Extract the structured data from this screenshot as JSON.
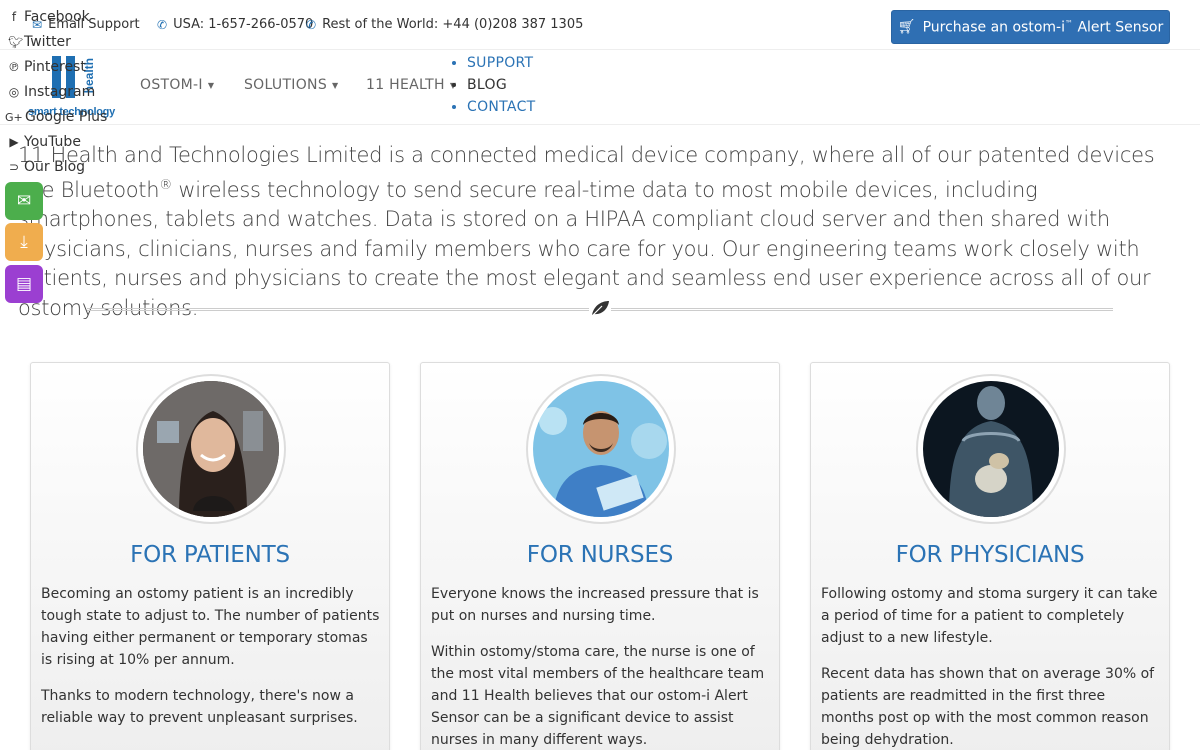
{
  "topbar": {
    "email_label": "Email Support",
    "usa_label": "USA: 1-657-266-0570",
    "world_label": "Rest of the World: +44 (0)208 387 1305",
    "purchase_label": "Purchase an ostom-i",
    "purchase_tm": "™",
    "purchase_suffix": "Alert Sensor"
  },
  "logo": {
    "health": "health",
    "tagline": "smart technology"
  },
  "nav": {
    "items": [
      {
        "label": "OSTOM-I"
      },
      {
        "label": "SOLUTIONS"
      },
      {
        "label": "11 HEALTH"
      }
    ],
    "links": [
      {
        "label": "SUPPORT"
      },
      {
        "label": "BLOG"
      },
      {
        "label": "CONTACT"
      }
    ]
  },
  "social": [
    {
      "icon": "facebook-icon",
      "label": "Facebook"
    },
    {
      "icon": "twitter-icon",
      "label": "Twitter"
    },
    {
      "icon": "pinterest-icon",
      "label": "Pinterest"
    },
    {
      "icon": "instagram-icon",
      "label": "Instagram"
    },
    {
      "icon": "google-plus-icon",
      "label": "Google Plus"
    },
    {
      "icon": "youtube-icon",
      "label": "YouTube"
    },
    {
      "icon": "rss-icon",
      "label": "Our Blog"
    }
  ],
  "float_buttons": [
    {
      "icon": "envelope-icon",
      "color": "#4cae4c"
    },
    {
      "icon": "download-icon",
      "color": "#f0ad4e"
    },
    {
      "icon": "newspaper-icon",
      "color": "#9b3fd1"
    }
  ],
  "intro": {
    "part1": "11 Health and Technologies Limited is a connected medical device company, where all of our patented devices use Bluetooth",
    "reg": "®",
    "part2": " wireless technology to send secure real-time data to most mobile devices, including smartphones, tablets and watches. Data is stored on a HIPAA compliant cloud server and then shared with physicians, clinicians, nurses and family members who care for you. Our engineering teams work closely with patients, nurses and physicians to create the most elegant and seamless end user experience across all of our ostomy solutions."
  },
  "cards": [
    {
      "title": "FOR PATIENTS",
      "image": "patient-photo",
      "paragraphs": [
        "Becoming an ostomy patient is an incredibly tough state to adjust to. The number of patients having either permanent or temporary stomas is rising at 10% per annum.",
        "Thanks to modern technology, there's now a reliable way to prevent unpleasant surprises."
      ]
    },
    {
      "title": "FOR NURSES",
      "image": "nurse-photo",
      "paragraphs": [
        "Everyone knows the increased pressure that is put on nurses and nursing time.",
        "Within ostomy/stoma care, the nurse is one of the most vital members of the healthcare team and 11 Health believes that our ostom-i Alert Sensor can be a significant device to assist nurses in many different ways."
      ]
    },
    {
      "title": "FOR PHYSICIANS",
      "image": "physician-xray-photo",
      "paragraphs": [
        "Following ostomy and stoma surgery it can take a period of time for a patient to completely adjust to a new lifestyle.",
        "Recent data has shown that on average 30% of patients are readmitted in the first three months post op with the most common reason being dehydration."
      ]
    }
  ],
  "colors": {
    "brand_blue": "#2b73b5",
    "button_blue": "#2f6fb3"
  }
}
